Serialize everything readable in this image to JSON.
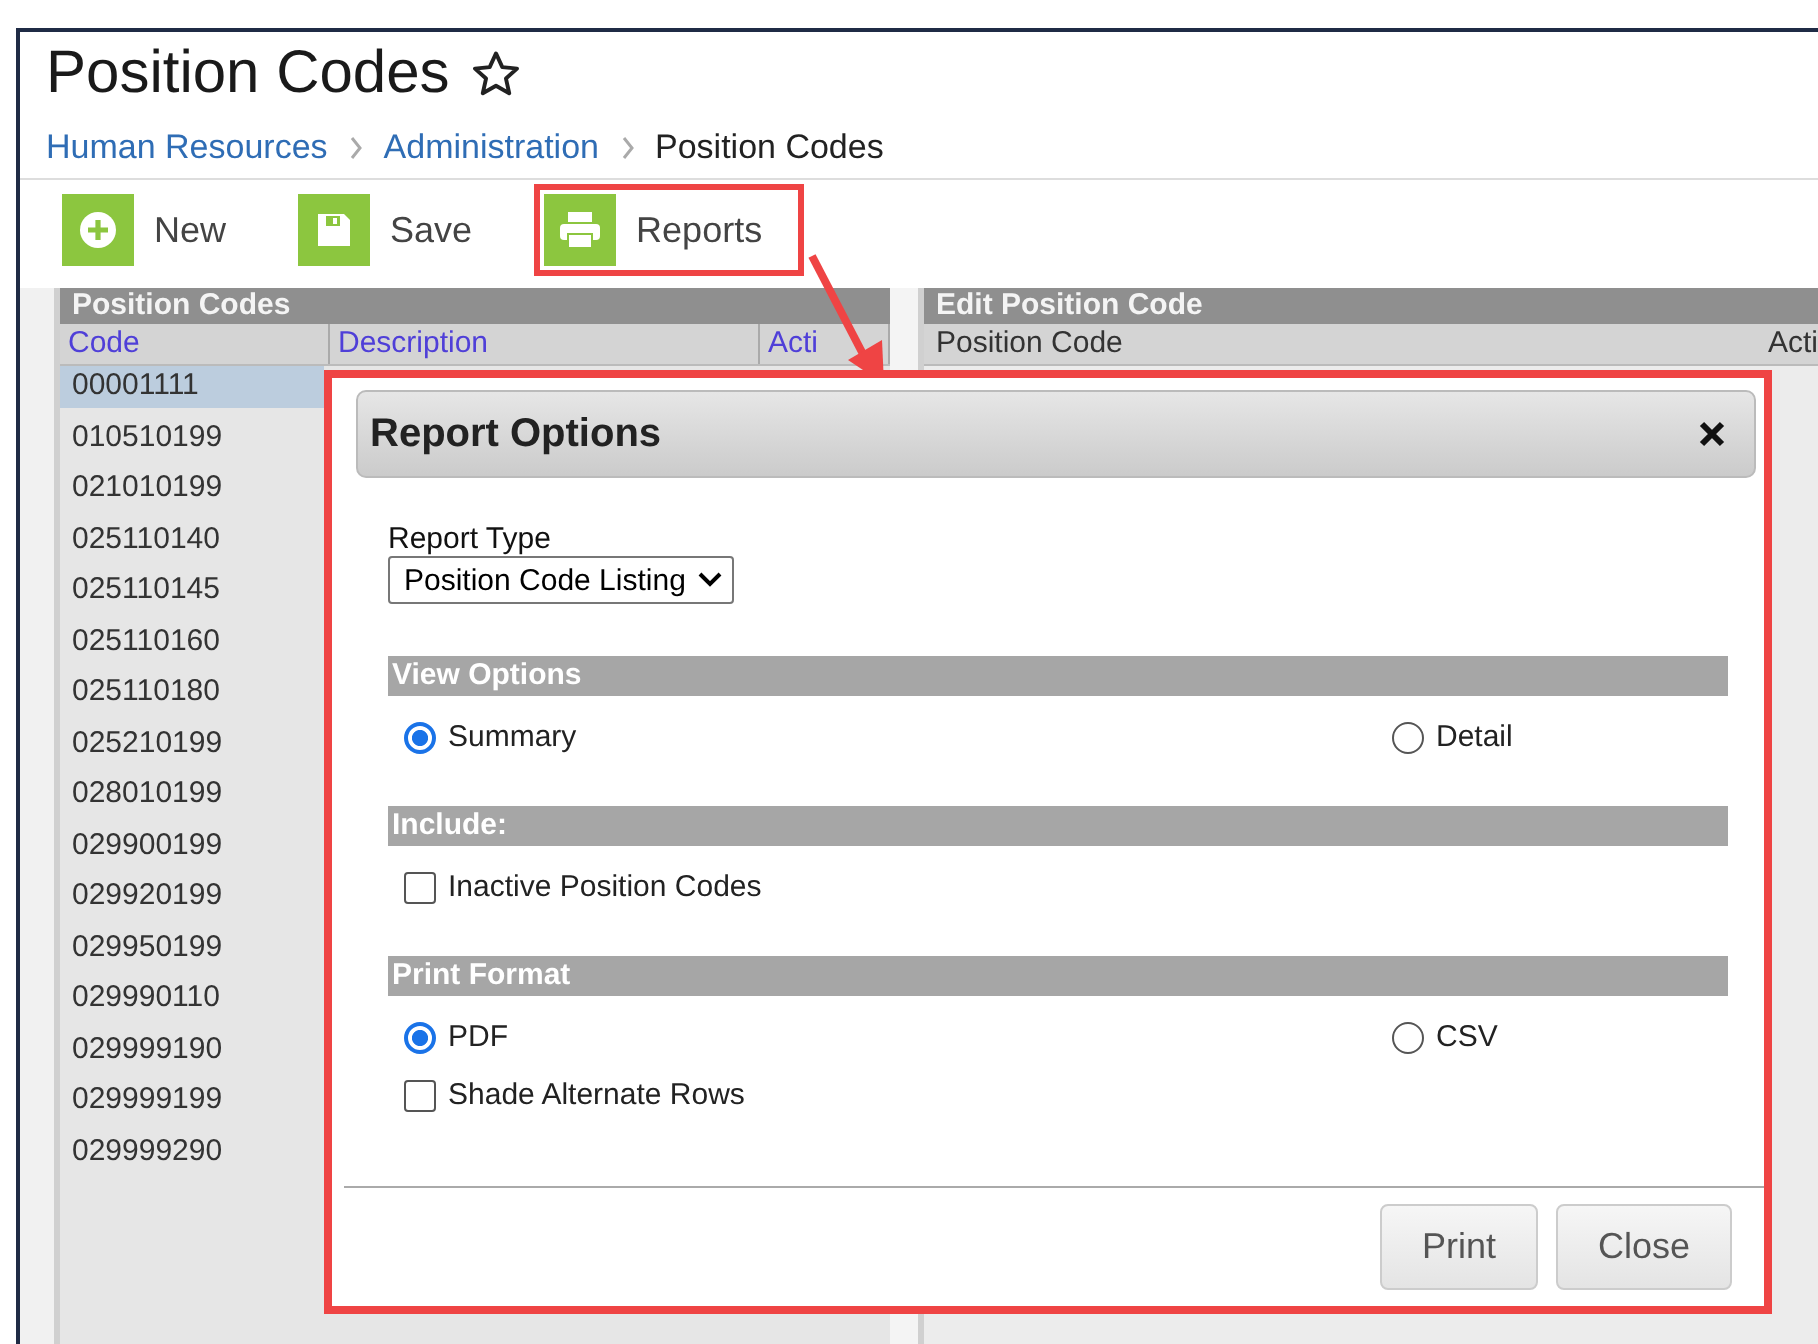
{
  "page": {
    "title": "Position Codes",
    "favorite": false
  },
  "breadcrumb": [
    {
      "label": "Human Resources",
      "link": true
    },
    {
      "label": "Administration",
      "link": true
    },
    {
      "label": "Position Codes",
      "link": false
    }
  ],
  "toolbar": [
    {
      "kind": "new",
      "label": "New",
      "highlighted": false
    },
    {
      "kind": "save",
      "label": "Save",
      "highlighted": false
    },
    {
      "kind": "reports",
      "label": "Reports",
      "highlighted": true
    }
  ],
  "list_panel": {
    "title": "Position Codes",
    "columns": [
      "Code",
      "Description",
      "Acti"
    ],
    "rows": [
      {
        "code": "00001111",
        "selected": true
      },
      {
        "code": "010510199",
        "selected": false
      },
      {
        "code": "021010199",
        "selected": false
      },
      {
        "code": "025110140",
        "selected": false
      },
      {
        "code": "025110145",
        "selected": false
      },
      {
        "code": "025110160",
        "selected": false
      },
      {
        "code": "025110180",
        "selected": false
      },
      {
        "code": "025210199",
        "selected": false
      },
      {
        "code": "028010199",
        "selected": false
      },
      {
        "code": "029900199",
        "selected": false
      },
      {
        "code": "029920199",
        "selected": false
      },
      {
        "code": "029950199",
        "selected": false
      },
      {
        "code": "029990110",
        "selected": false
      },
      {
        "code": "029999190",
        "selected": false
      },
      {
        "code": "029999199",
        "selected": false
      },
      {
        "code": "029999290",
        "selected": false
      }
    ]
  },
  "edit_panel": {
    "title": "Edit Position Code",
    "columns": [
      "Position Code",
      "Acti"
    ]
  },
  "dialog": {
    "title": "Report Options",
    "highlighted": true,
    "report_type": {
      "label": "Report Type",
      "value": "Position Code Listing"
    },
    "sections": [
      {
        "title": "View Options",
        "options": [
          {
            "kind": "radio",
            "label": "Summary",
            "selected": true
          },
          {
            "kind": "radio",
            "label": "Detail",
            "selected": false
          }
        ]
      },
      {
        "title": "Include:",
        "options": [
          {
            "kind": "checkbox",
            "label": "Inactive Position Codes",
            "checked": false
          }
        ]
      },
      {
        "title": "Print Format",
        "options": [
          {
            "kind": "radio",
            "label": "PDF",
            "selected": true
          },
          {
            "kind": "radio",
            "label": "CSV",
            "selected": false
          },
          {
            "kind": "checkbox",
            "label": "Shade Alternate Rows",
            "checked": false
          }
        ]
      }
    ],
    "buttons": [
      "Print",
      "Close"
    ]
  }
}
